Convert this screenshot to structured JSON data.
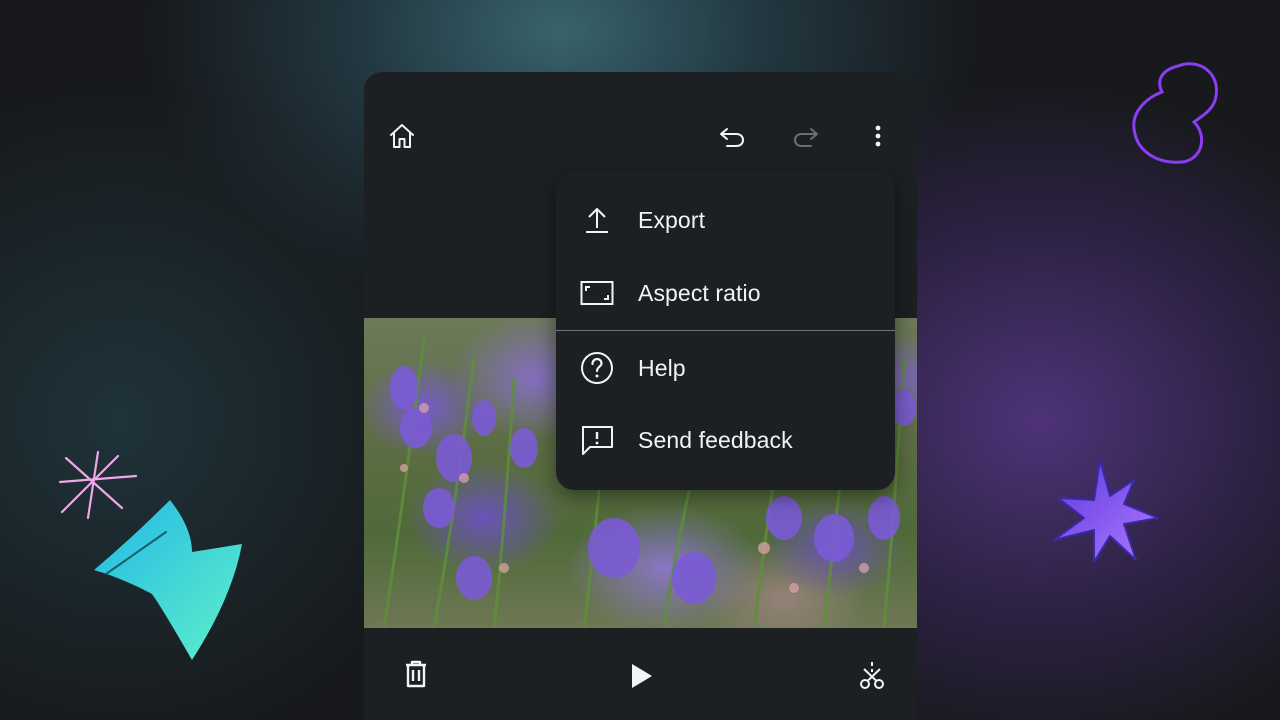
{
  "toolbar": {
    "home_icon": "home-icon",
    "undo_icon": "undo-icon",
    "redo_icon": "redo-icon",
    "more_icon": "more-vert-icon"
  },
  "menu": {
    "items": [
      {
        "label": "Export",
        "icon": "upload-icon"
      },
      {
        "label": "Aspect ratio",
        "icon": "aspect-ratio-icon"
      },
      {
        "label": "Help",
        "icon": "help-icon"
      },
      {
        "label": "Send feedback",
        "icon": "feedback-icon"
      }
    ]
  },
  "bottom_bar": {
    "delete_icon": "trash-icon",
    "play_icon": "play-icon",
    "trim_icon": "scissors-icon"
  },
  "colors": {
    "panel": "#1d2022",
    "text": "#f1f3f4",
    "disabled": "#6b6f72",
    "accent_purple": "#8b5cf6",
    "accent_teal": "#2dd4bf",
    "accent_pink": "#f0a6e8"
  }
}
